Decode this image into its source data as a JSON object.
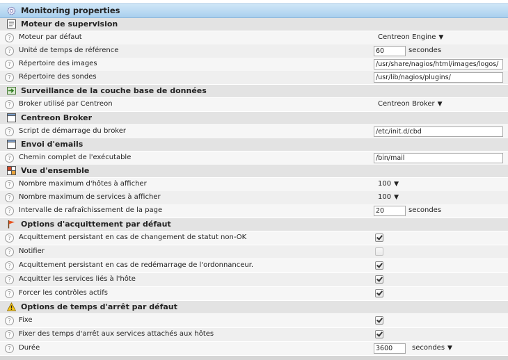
{
  "page": {
    "title": "Monitoring properties"
  },
  "sections": {
    "engine": {
      "title": "Moteur de supervision",
      "default_engine_label": "Moteur par défaut",
      "default_engine_value": "Centreon Engine",
      "ref_time_label": "Unité de temps de référence",
      "ref_time_value": "60",
      "ref_time_unit": "secondes",
      "images_dir_label": "Répertoire des images",
      "images_dir_value": "/usr/share/nagios/html/images/logos/",
      "plugins_dir_label": "Répertoire des sondes",
      "plugins_dir_value": "/usr/lib/nagios/plugins/"
    },
    "db": {
      "title": "Surveillance de la couche base de données",
      "broker_label": "Broker utilisé par Centreon",
      "broker_value": "Centreon Broker"
    },
    "broker": {
      "title": "Centreon Broker",
      "script_label": "Script de démarrage du broker",
      "script_value": "/etc/init.d/cbd"
    },
    "mail": {
      "title": "Envoi d'emails",
      "path_label": "Chemin complet de l'exécutable",
      "path_value": "/bin/mail"
    },
    "overview": {
      "title": "Vue d'ensemble",
      "max_hosts_label": "Nombre maximum d'hôtes à afficher",
      "max_hosts_value": "100",
      "max_services_label": "Nombre maximum de services à afficher",
      "max_services_value": "100",
      "refresh_label": "Intervalle de rafraîchissement de la page",
      "refresh_value": "20",
      "refresh_unit": "secondes"
    },
    "ack": {
      "title": "Options d'acquittement par défaut",
      "sticky_label": "Acquittement persistant en cas de changement de statut non-OK",
      "sticky_checked": true,
      "notify_label": "Notifier",
      "notify_checked": false,
      "persistent_label": "Acquittement persistant en cas de redémarrage de l'ordonnanceur.",
      "persistent_checked": true,
      "services_label": "Acquitter les services liés à l'hôte",
      "services_checked": true,
      "force_label": "Forcer les contrôles actifs",
      "force_checked": true
    },
    "downtime": {
      "title": "Options de temps d'arrêt par défaut",
      "fixed_label": "Fixe",
      "fixed_checked": true,
      "with_services_label": "Fixer des temps d'arrêt aux services attachés aux hôtes",
      "with_services_checked": true,
      "duration_label": "Durée",
      "duration_value": "3600",
      "duration_unit": "secondes"
    }
  },
  "icons": {
    "title": "gear-icon",
    "engine": "list-icon",
    "db": "arrow-in-icon",
    "broker": "window-icon",
    "mail": "window-icon",
    "overview": "grid-icon",
    "ack": "flag-icon",
    "downtime": "warning-icon",
    "help": "help-icon"
  },
  "colors": {
    "title_bar": "#a9cfee",
    "section_bar": "#e3e3e3",
    "row_bg": "#f6f6f6"
  }
}
